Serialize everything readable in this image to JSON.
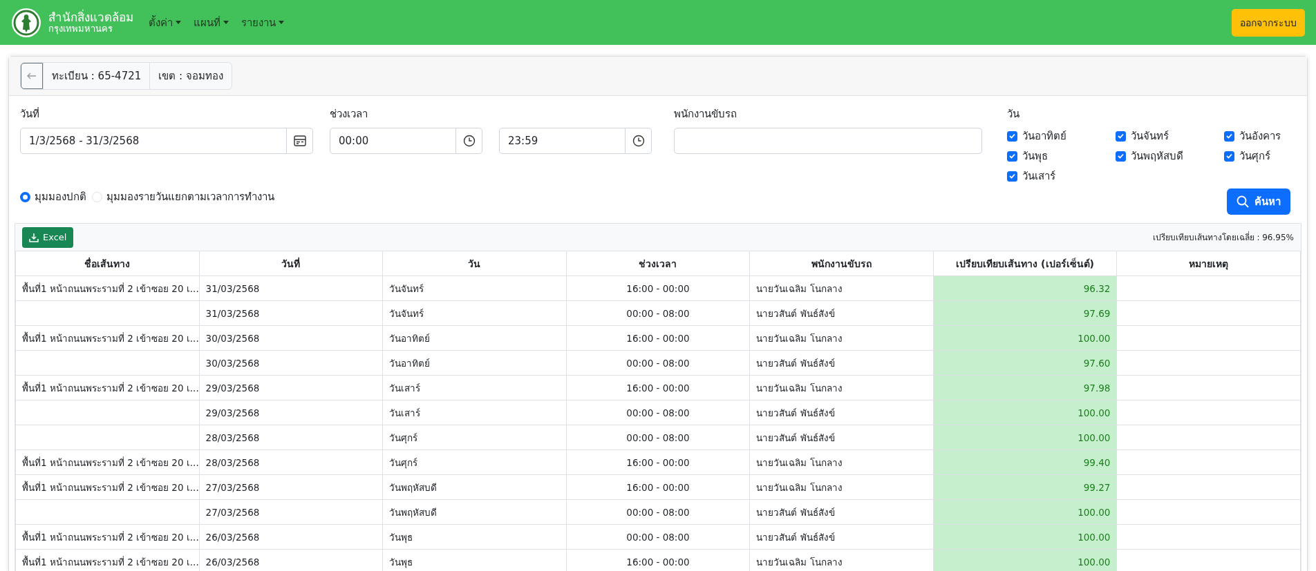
{
  "navbar": {
    "brand_title": "สำนักสิ่งแวดล้อม",
    "brand_subtitle": "กรุงเทพมหานคร",
    "menus": [
      "ตั้งค่า",
      "แผนที่",
      "รายงาน"
    ],
    "logout": "ออกจากระบบ"
  },
  "info_bar": {
    "registration": "ทะเบียน : 65-4721",
    "district": "เขต : จอมทอง"
  },
  "filters": {
    "date_label": "วันที่",
    "date_value": "1/3/2568 - 31/3/2568",
    "time_label": "ช่วงเวลา",
    "time_from": "00:00",
    "time_to": "23:59",
    "driver_label": "พนักงานขับรถ",
    "days_label": "วัน",
    "days": [
      {
        "label": "วันอาทิตย์",
        "checked": true
      },
      {
        "label": "วันจันทร์",
        "checked": true
      },
      {
        "label": "วันอังคาร",
        "checked": true
      },
      {
        "label": "วันพุธ",
        "checked": true
      },
      {
        "label": "วันพฤหัสบดี",
        "checked": true
      },
      {
        "label": "วันศุกร์",
        "checked": true
      },
      {
        "label": "วันเสาร์",
        "checked": true
      }
    ],
    "views": [
      {
        "label": "มุมมองปกติ",
        "selected": true
      },
      {
        "label": "มุมมองรายวันแยกตามเวลาการทำงาน",
        "selected": false
      }
    ],
    "search_button": "ค้นหา"
  },
  "table": {
    "excel_button": "Excel",
    "average": "เปรียบเทียบเส้นทางโดยเฉลี่ย : 96.95%",
    "columns": [
      "ชื่อเส้นทาง",
      "วันที่",
      "วัน",
      "ช่วงเวลา",
      "พนักงานขับรถ",
      "เปรียบเทียบเส้นทาง (เปอร์เซ็นต์)",
      "หมายเหตุ"
    ],
    "rows": [
      [
        "พื้นที่1 หน้าถนนพระรามที่ 2 เข้าซอย 20 เ...",
        "31/03/2568",
        "วันจันทร์",
        "16:00 - 00:00",
        "นายวันเฉลิม โนกลาง",
        "96.32"
      ],
      [
        "",
        "31/03/2568",
        "วันจันทร์",
        "00:00 - 08:00",
        "นายวสันต์ พันธ์สังข์",
        "97.69"
      ],
      [
        "พื้นที่1 หน้าถนนพระรามที่ 2 เข้าซอย 20 เ...",
        "30/03/2568",
        "วันอาทิตย์",
        "16:00 - 00:00",
        "นายวันเฉลิม โนกลาง",
        "100.00"
      ],
      [
        "",
        "30/03/2568",
        "วันอาทิตย์",
        "00:00 - 08:00",
        "นายวสันต์ พันธ์สังข์",
        "97.60"
      ],
      [
        "พื้นที่1 หน้าถนนพระรามที่ 2 เข้าซอย 20 เ...",
        "29/03/2568",
        "วันเสาร์",
        "16:00 - 00:00",
        "นายวันเฉลิม โนกลาง",
        "97.98"
      ],
      [
        "",
        "29/03/2568",
        "วันเสาร์",
        "00:00 - 08:00",
        "นายวสันต์ พันธ์สังข์",
        "100.00"
      ],
      [
        "",
        "28/03/2568",
        "วันศุกร์",
        "00:00 - 08:00",
        "นายวสันต์ พันธ์สังข์",
        "100.00"
      ],
      [
        "พื้นที่1 หน้าถนนพระรามที่ 2 เข้าซอย 20 เ...",
        "28/03/2568",
        "วันศุกร์",
        "16:00 - 00:00",
        "นายวันเฉลิม โนกลาง",
        "99.40"
      ],
      [
        "พื้นที่1 หน้าถนนพระรามที่ 2 เข้าซอย 20 เ...",
        "27/03/2568",
        "วันพฤหัสบดี",
        "16:00 - 00:00",
        "นายวันเฉลิม โนกลาง",
        "99.27"
      ],
      [
        "",
        "27/03/2568",
        "วันพฤหัสบดี",
        "00:00 - 08:00",
        "นายวสันต์ พันธ์สังข์",
        "100.00"
      ],
      [
        "พื้นที่1 หน้าถนนพระรามที่ 2 เข้าซอย 20 เ...",
        "26/03/2568",
        "วันพุธ",
        "00:00 - 08:00",
        "นายวสันต์ พันธ์สังข์",
        "100.00"
      ],
      [
        "พื้นที่1 หน้าถนนพระรามที่ 2 เข้าซอย 20 เ...",
        "26/03/2568",
        "วันพุธ",
        "16:00 - 00:00",
        "นายวันเฉลิม โนกลาง",
        "100.00"
      ]
    ]
  }
}
